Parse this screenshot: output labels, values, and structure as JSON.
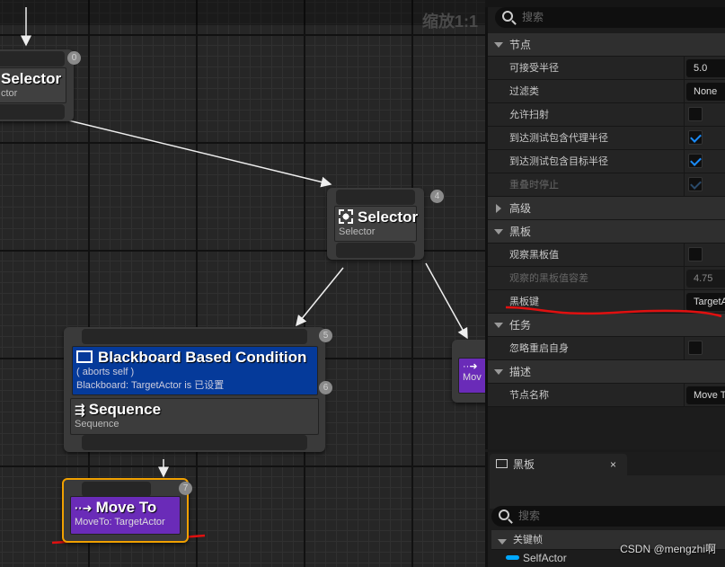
{
  "graph": {
    "zoom_label": "缩放1:1",
    "nodes": [
      {
        "id": "0",
        "title": "Selector",
        "subtitle": "ctor"
      },
      {
        "id": "4",
        "title": "Selector",
        "subtitle": "Selector"
      },
      {
        "id": "5",
        "title": "Blackboard Based Condition",
        "line1": "( aborts self )",
        "line2": "Blackboard: TargetActor is 已设置"
      },
      {
        "id": "6",
        "title": "Sequence",
        "subtitle": "Sequence"
      },
      {
        "id": "7",
        "title": "Move To",
        "subtitle": "MoveTo: TargetActor"
      },
      {
        "id": "partial",
        "subtitle": "Mov"
      }
    ]
  },
  "details": {
    "search_placeholder": "搜索",
    "categories": [
      {
        "label": "节点",
        "rows": [
          {
            "label": "可接受半径",
            "value": "5.0"
          },
          {
            "label": "过滤类",
            "value": "None"
          },
          {
            "label": "允许扫射",
            "checked": false
          },
          {
            "label": "到达测试包含代理半径",
            "checked": true
          },
          {
            "label": "到达测试包含目标半径",
            "checked": true
          },
          {
            "label": "重叠时停止",
            "checked": true,
            "disabled": true
          }
        ]
      },
      {
        "label": "高级"
      },
      {
        "label": "黑板",
        "rows": [
          {
            "label": "观察黑板值",
            "checked": false
          },
          {
            "label": "观察的黑板值容差",
            "value": "4.75"
          },
          {
            "label": "黑板键",
            "value": "TargetActor"
          }
        ]
      },
      {
        "label": "任务",
        "rows": [
          {
            "label": "忽略重启自身",
            "checked": false
          }
        ]
      },
      {
        "label": "描述",
        "rows": [
          {
            "label": "节点名称",
            "value": "Move To"
          }
        ]
      }
    ]
  },
  "blackboard": {
    "tab_label": "黑板",
    "close": "×",
    "search_placeholder": "搜索",
    "group": "关键帧",
    "keys": [
      "SelfActor"
    ]
  },
  "watermark": "CSDN @mengzhi啊",
  "colors": {
    "decorator": "#053a9a",
    "task": "#6a2bb8",
    "selected": "#f0a000",
    "annotation": "#e01010"
  }
}
